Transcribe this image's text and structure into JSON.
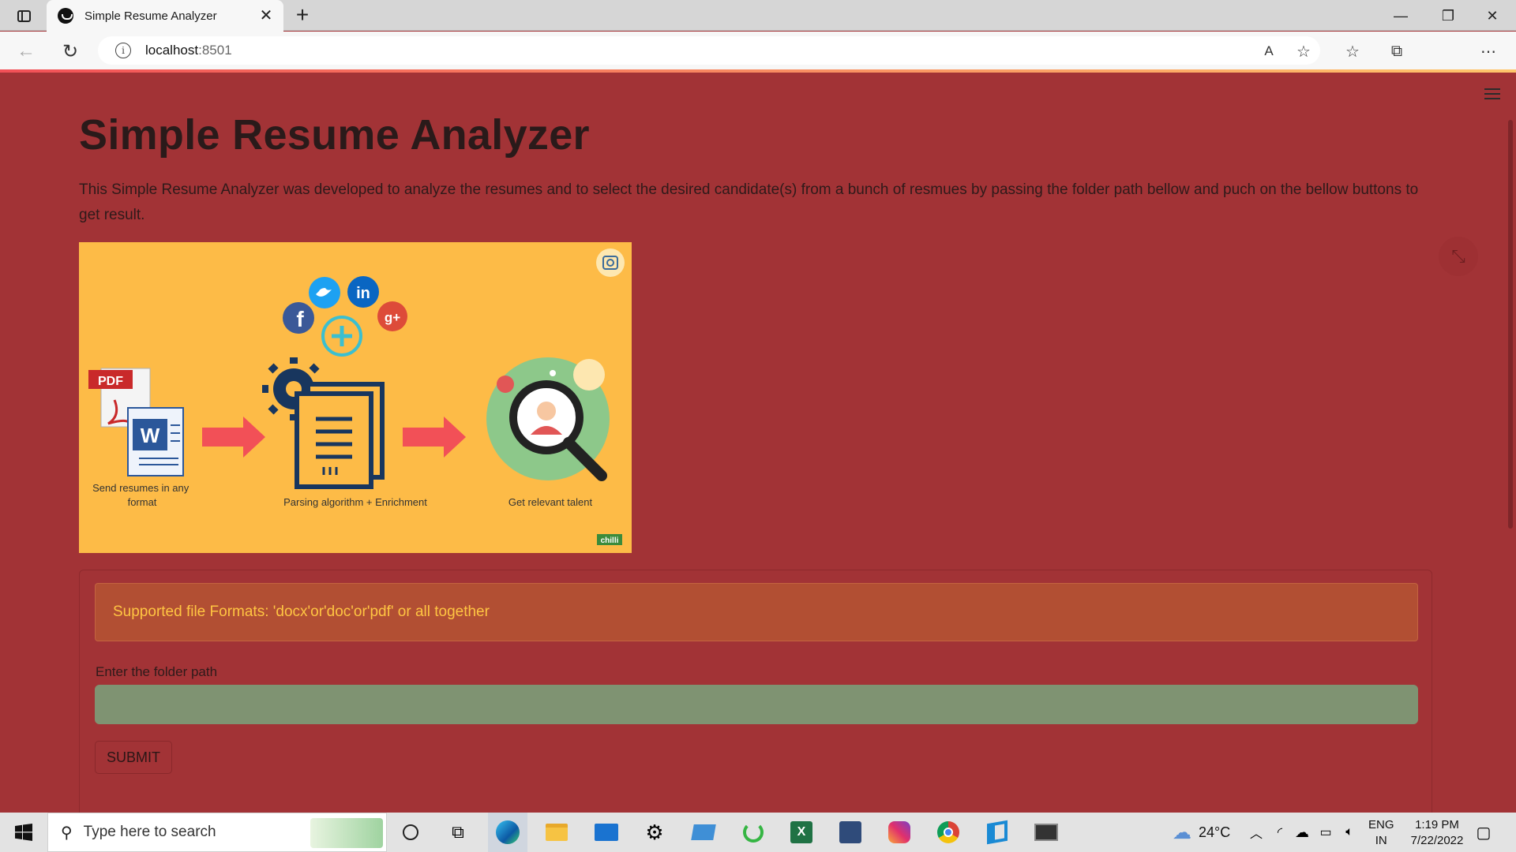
{
  "browser": {
    "tab_title": "Simple Resume Analyzer",
    "url_host": "localhost",
    "url_port": ":8501"
  },
  "app": {
    "title": "Simple Resume Analyzer",
    "description": "This Simple Resume Analyzer was developed to analyze the resumes and to select the desired candidate(s) from a bunch of resmues by passing the folder path bellow and puch on the bellow buttons to get result.",
    "banner": {
      "pdf_label": "PDF",
      "step1": "Send resumes in any format",
      "step2": "Parsing algorithm + Enrichment",
      "step3": "Get relevant talent",
      "brand": "chilli"
    },
    "alert": "Supported file Formats: 'docx'or'doc'or'pdf' or all together",
    "path_label": "Enter the folder path",
    "path_value": "",
    "submit_label": "SUBMIT"
  },
  "taskbar": {
    "search_placeholder": "Type here to search",
    "temperature": "24°C",
    "lang_1": "ENG",
    "lang_2": "IN",
    "time": "1:19 PM",
    "date": "7/22/2022"
  },
  "colors": {
    "app_background": "#a23336",
    "alert_text": "#ffc542",
    "input_background": "#7f9372",
    "banner_background": "#fdbb47"
  }
}
